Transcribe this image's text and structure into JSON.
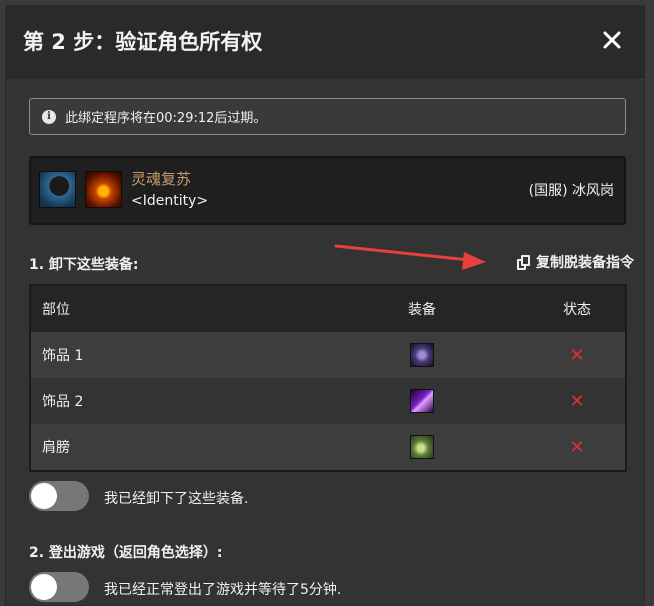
{
  "modal": {
    "title": "第 2 步：验证角色所有权",
    "close_label": "×"
  },
  "notice": {
    "icon": "info-icon",
    "text": "此绑定程序将在00:29:12后过期。"
  },
  "character": {
    "name": "灵魂复苏",
    "guild": "<Identity>",
    "realm": "(国服) 冰风岗",
    "name_color": "#c79c6e"
  },
  "step1": {
    "label": "1. 卸下这些装备:",
    "copy_command_label": "复制脱装备指令",
    "table": {
      "headers": {
        "slot": "部位",
        "item": "装备",
        "status": "状态"
      },
      "rows": [
        {
          "slot": "饰品 1",
          "item_icon": "trinket-1-icon",
          "status": "✕"
        },
        {
          "slot": "饰品 2",
          "item_icon": "trinket-2-icon",
          "status": "✕"
        },
        {
          "slot": "肩膀",
          "item_icon": "shoulder-icon",
          "status": "✕"
        }
      ]
    },
    "confirm_toggle_label": "我已经卸下了这些装备."
  },
  "step2": {
    "label": "2. 登出游戏（返回角色选择）:",
    "confirm_toggle_label": "我已经正常登出了游戏并等待了5分钟."
  },
  "colors": {
    "status_fail": "#e03030",
    "annotation_arrow": "#e8403a"
  }
}
